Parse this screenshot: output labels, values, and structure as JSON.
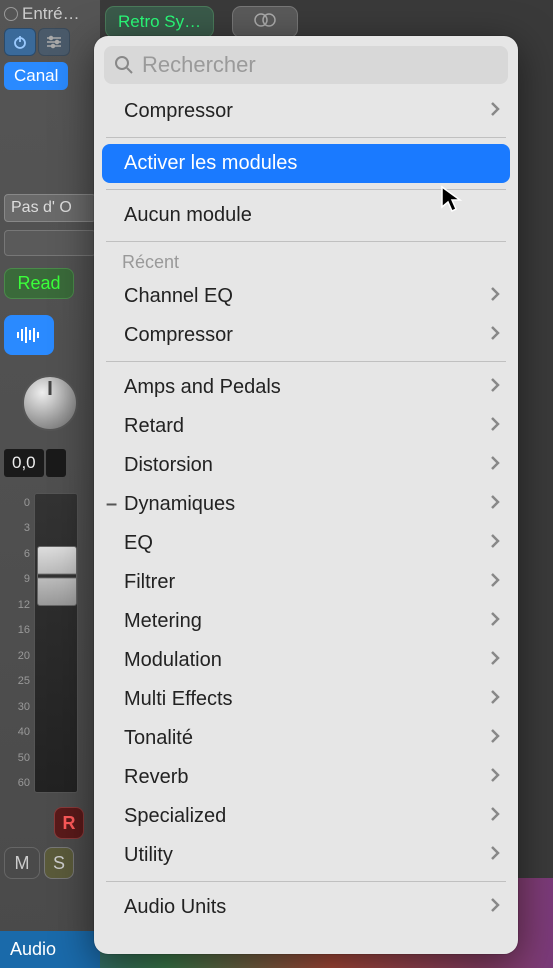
{
  "channel": {
    "input_label": "Entré…",
    "canal_label": "Canal",
    "send_label": "Pas d' O",
    "automation_label": "Read",
    "pan_value": "0,0",
    "track_label": "Audio",
    "mute_label": "M",
    "solo_label": "S",
    "rec_label": "R",
    "fader_ticks": [
      "0",
      "3",
      "6",
      "9",
      "12",
      "16",
      "20",
      "25",
      "30",
      "40",
      "50",
      "60"
    ]
  },
  "header": {
    "pill1": "Retro Sy…"
  },
  "search": {
    "placeholder": "Rechercher"
  },
  "menu": {
    "current": "Compressor",
    "activate": "Activer les modules",
    "none": "Aucun module",
    "recent_header": "Récent",
    "recent": [
      "Channel EQ",
      "Compressor"
    ],
    "categories": [
      {
        "label": "Amps and Pedals"
      },
      {
        "label": "Retard"
      },
      {
        "label": "Distorsion"
      },
      {
        "label": "Dynamiques",
        "marked": true
      },
      {
        "label": "EQ"
      },
      {
        "label": "Filtrer"
      },
      {
        "label": "Metering"
      },
      {
        "label": "Modulation"
      },
      {
        "label": "Multi Effects"
      },
      {
        "label": "Tonalité"
      },
      {
        "label": "Reverb"
      },
      {
        "label": "Specialized"
      },
      {
        "label": "Utility"
      }
    ],
    "au": "Audio Units"
  }
}
